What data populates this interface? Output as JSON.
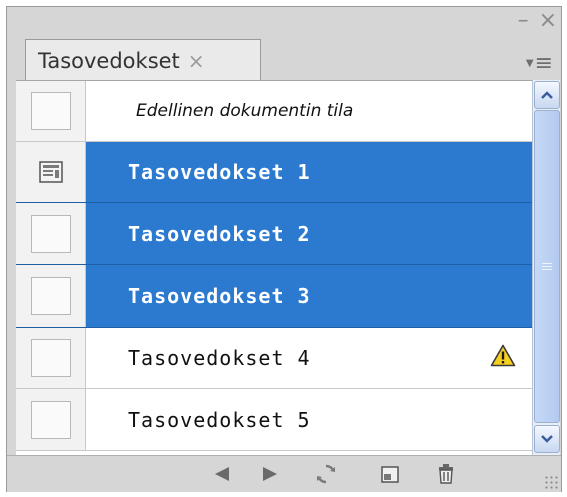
{
  "panel": {
    "tab_title": "Tasovedokset",
    "tab_close": "×",
    "minimize_glyph": "–",
    "close_glyph": "×",
    "menu_glyph": "≡"
  },
  "rows": [
    {
      "label": "Edellinen dokumentin tila",
      "selected": false,
      "icon": "none"
    },
    {
      "label": "Tasovedokset 1",
      "selected": true,
      "icon": "layer-comp-applied-icon"
    },
    {
      "label": "Tasovedokset 2",
      "selected": true,
      "icon": "none"
    },
    {
      "label": "Tasovedokset 3",
      "selected": true,
      "icon": "none"
    },
    {
      "label": "Tasovedokset 4",
      "selected": false,
      "icon": "warning-icon"
    },
    {
      "label": "Tasovedokset 5",
      "selected": false,
      "icon": "none"
    }
  ],
  "footer": {
    "buttons": [
      "previous-comp-icon",
      "next-comp-icon",
      "update-comp-icon",
      "new-comp-icon",
      "delete-comp-icon"
    ]
  },
  "colors": {
    "selection": "#2b7ad0",
    "panel_bg": "#d6d6d6",
    "scrollbar": "#c6d8f6"
  }
}
